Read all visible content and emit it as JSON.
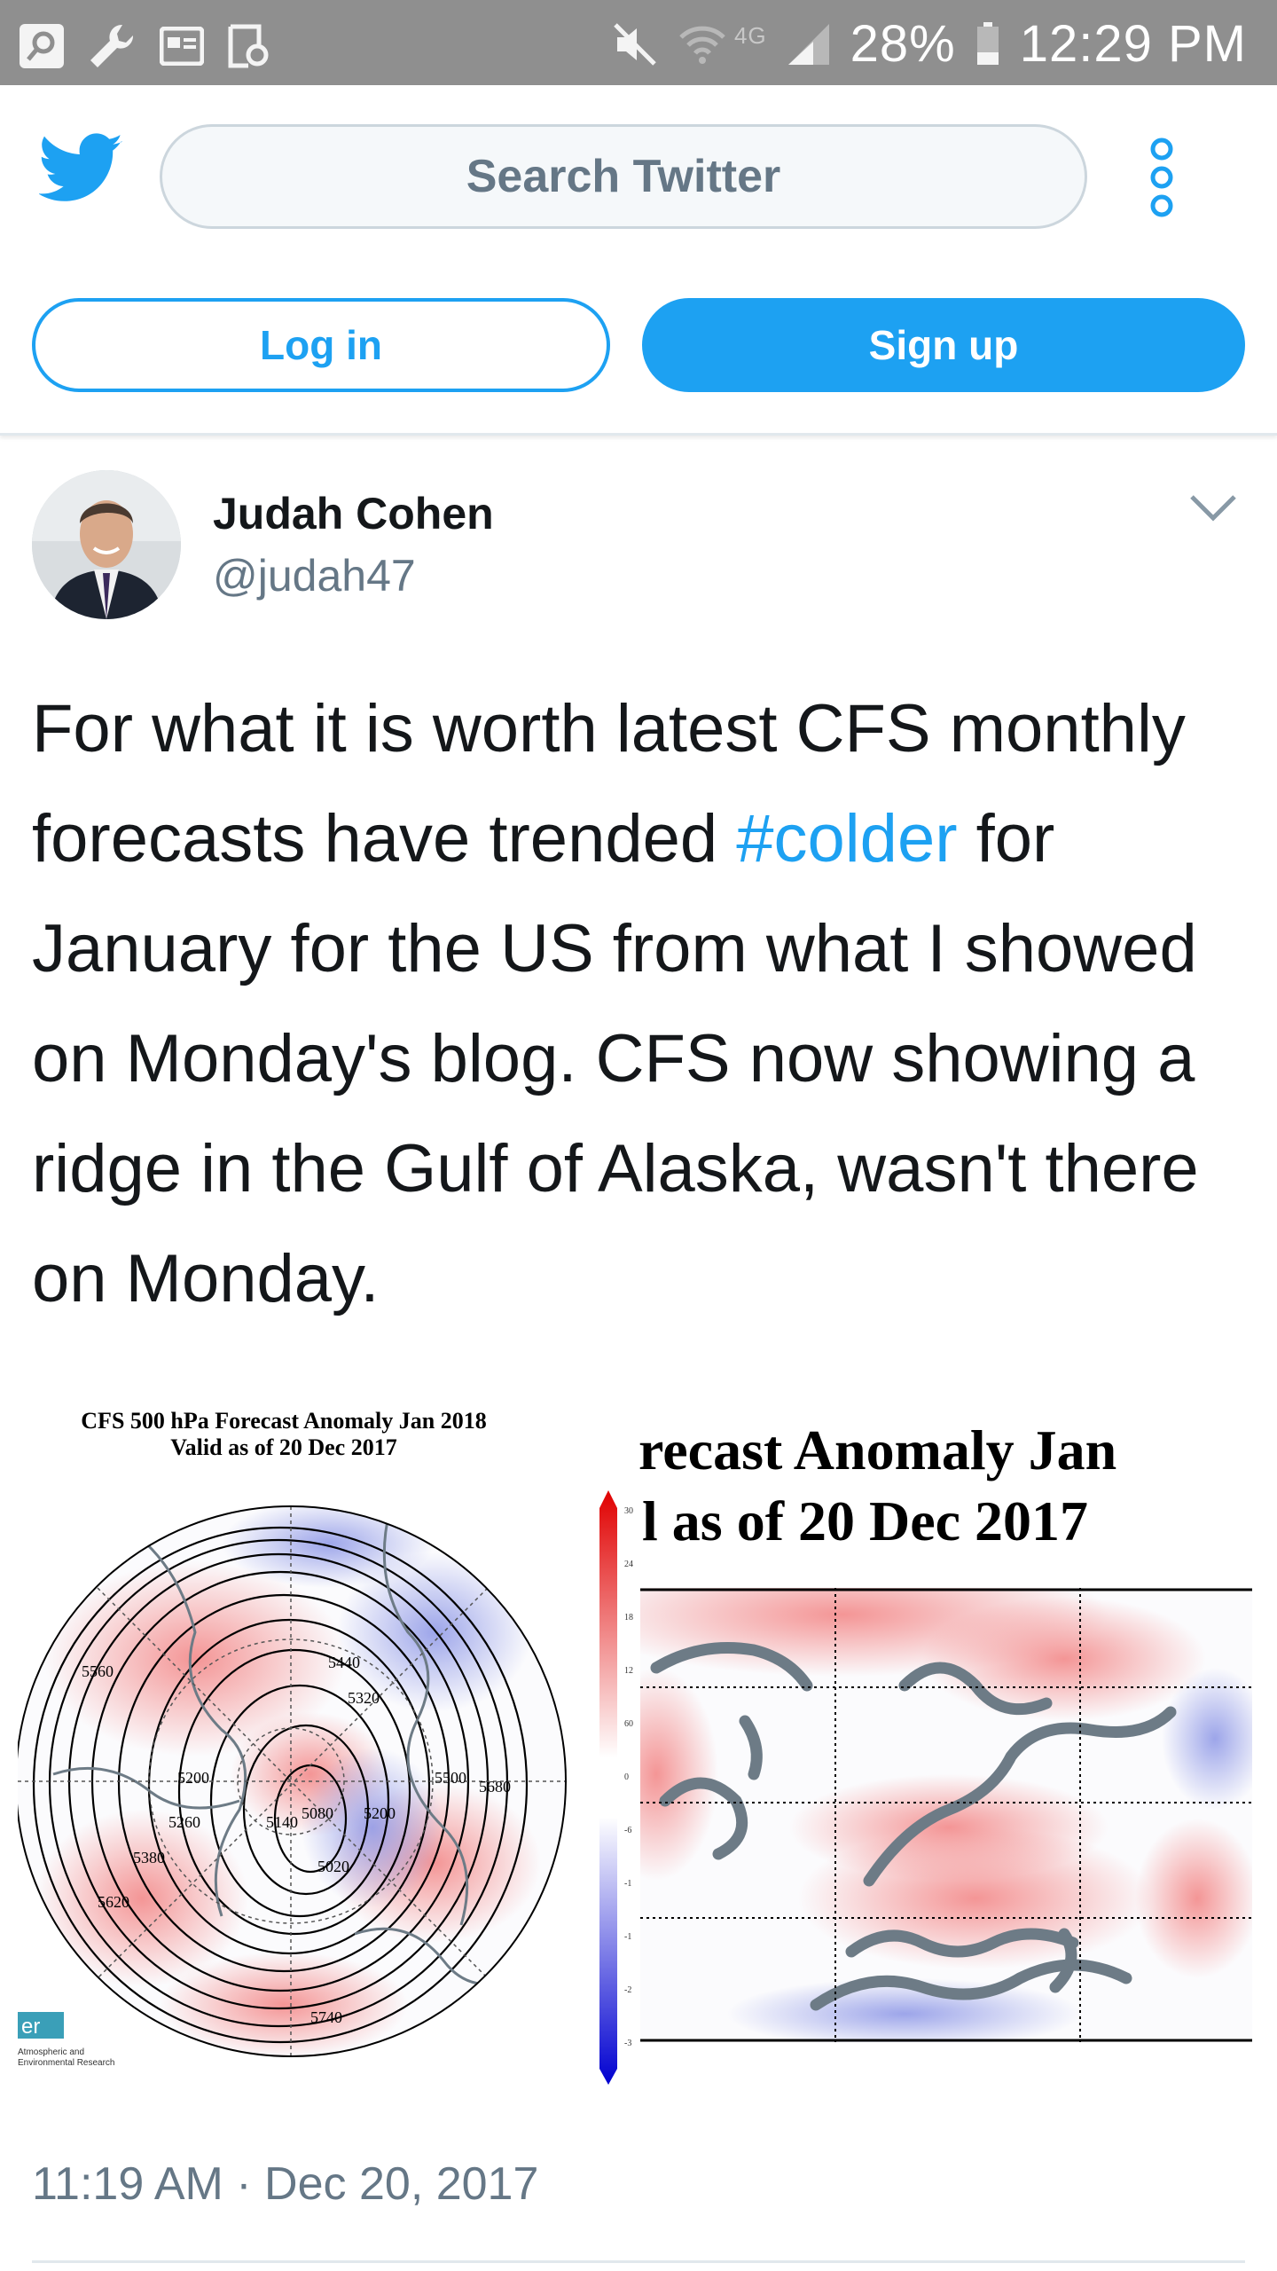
{
  "status_bar": {
    "network": "4G",
    "battery": "28%",
    "time": "12:29 PM",
    "left_icons": [
      "search-icon",
      "wrench-icon",
      "card-icon",
      "screenshot-icon"
    ],
    "right_icons": [
      "mute-icon",
      "wifi-icon",
      "signal-icon",
      "battery-icon"
    ]
  },
  "header": {
    "search_placeholder": "Search Twitter",
    "login_label": "Log in",
    "signup_label": "Sign up"
  },
  "tweet": {
    "author_name": "Judah Cohen",
    "author_handle": "@judah47",
    "text_before": "For what it is worth latest CFS monthly forecasts have trended ",
    "hashtag": "#colder",
    "text_after": " for January for the US from what I showed on Monday's blog. CFS now showing a ridge in the Gulf of Alaska, wasn't there on Monday.",
    "timestamp": "11:19 AM · Dec 20, 2017"
  },
  "media": {
    "left_title_line1": "CFS 500 hPa Forecast Anomaly Jan 2018",
    "left_title_line2": "Valid as of 20 Dec 2017",
    "right_title_line1": "recast Anomaly Jan",
    "right_title_line2": "l as of 20 Dec 2017",
    "contour_labels": [
      "5440",
      "5320",
      "5560",
      "5200",
      "5260",
      "5380",
      "5620",
      "5140",
      "5080",
      "5020",
      "5200",
      "5500",
      "5680",
      "5740"
    ],
    "colorbar_ticks": [
      "30",
      "24",
      "18",
      "12",
      "60",
      "0",
      "-6",
      "-1",
      "-1",
      "-2",
      "-3"
    ],
    "logo_text": "er",
    "logo_caption_line1": "Atmospheric and",
    "logo_caption_line2": "Environmental Research",
    "colors": {
      "warm": "#f08080",
      "cold": "#8c96e6",
      "land": "#6d7b86"
    }
  }
}
